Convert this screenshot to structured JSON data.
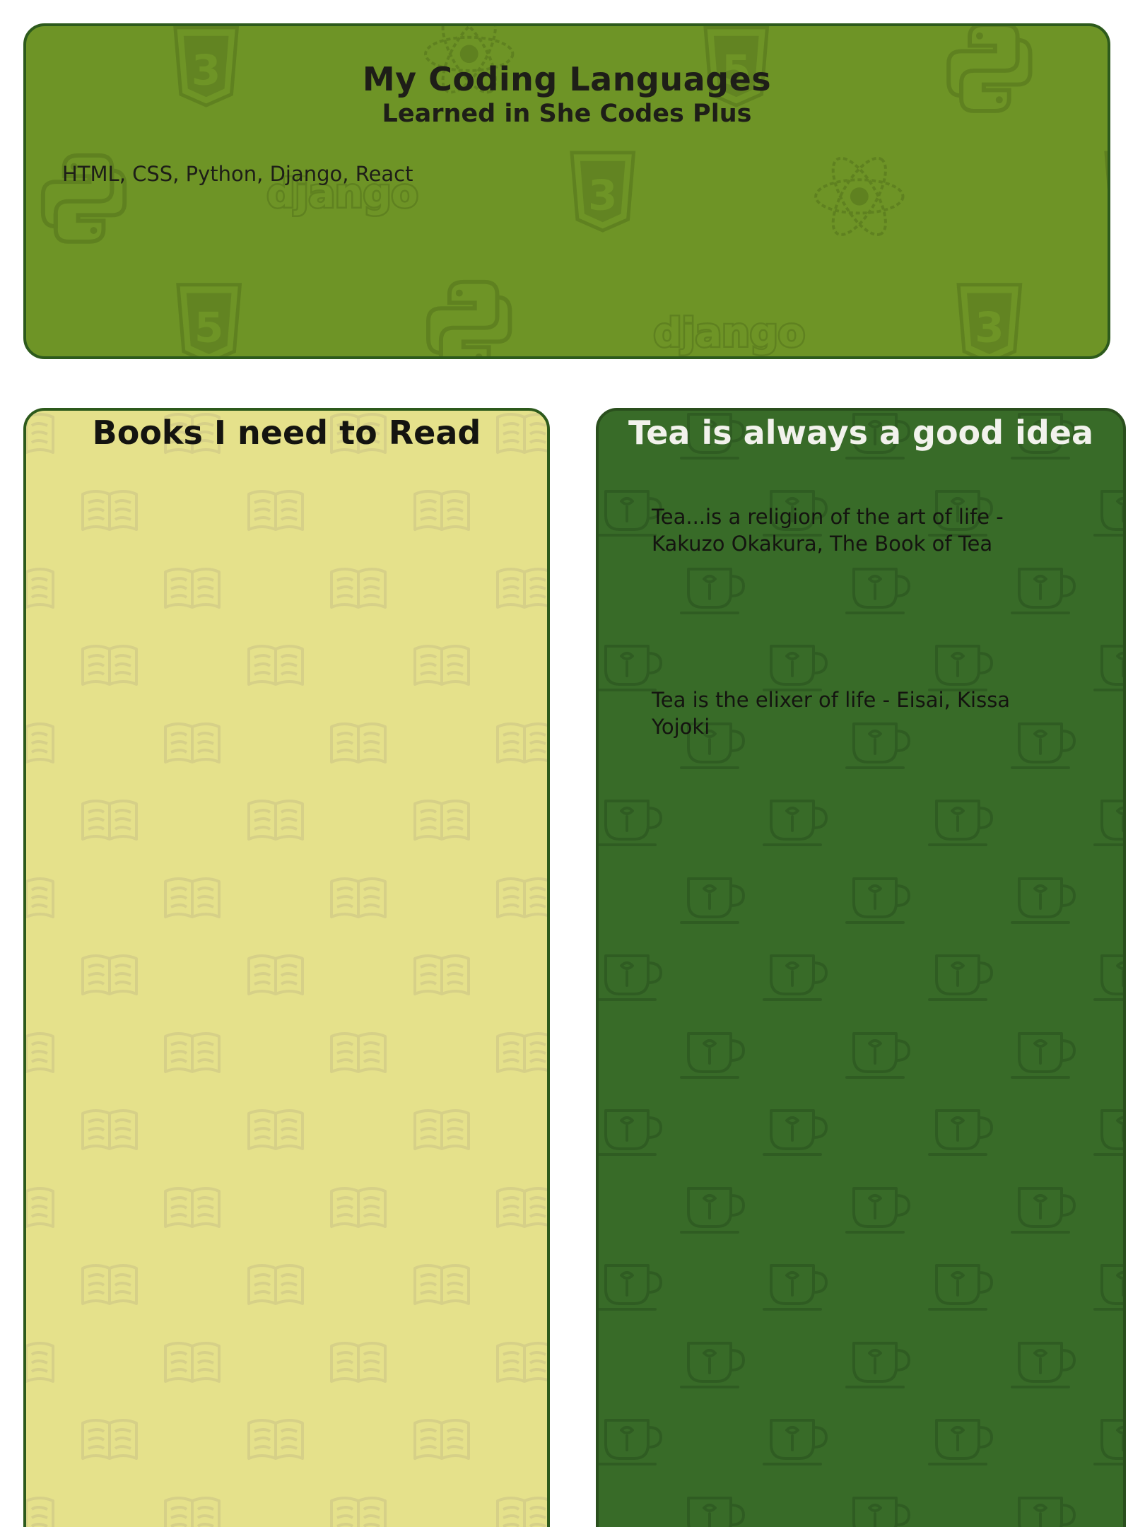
{
  "languages_card": {
    "title": "My Coding Languages",
    "subtitle": "Learned in She Codes Plus",
    "list": "HTML, CSS, Python, Django, React",
    "background_color": "#6e9426",
    "border_color": "#2d5a1c",
    "pattern_icons": [
      "css3-icon",
      "html5-icon",
      "react-icon",
      "python-icon",
      "django-logo"
    ]
  },
  "books_card": {
    "title": "Books I need to Read",
    "background_color": "#e5e18b",
    "pattern_icon": "open-book-icon"
  },
  "tea_card": {
    "title": "Tea is always a good idea",
    "quotes": [
      "Tea...is a religion of the art of life - Kakuzo Okakura, The Book of Tea",
      "Tea is the elixer of life - Eisai, Kissa Yojoki"
    ],
    "background_color": "#386b28",
    "pattern_icon": "tea-cup-icon"
  },
  "pattern_labels": {
    "django": "django",
    "css_number": "3",
    "html_number": "5"
  }
}
